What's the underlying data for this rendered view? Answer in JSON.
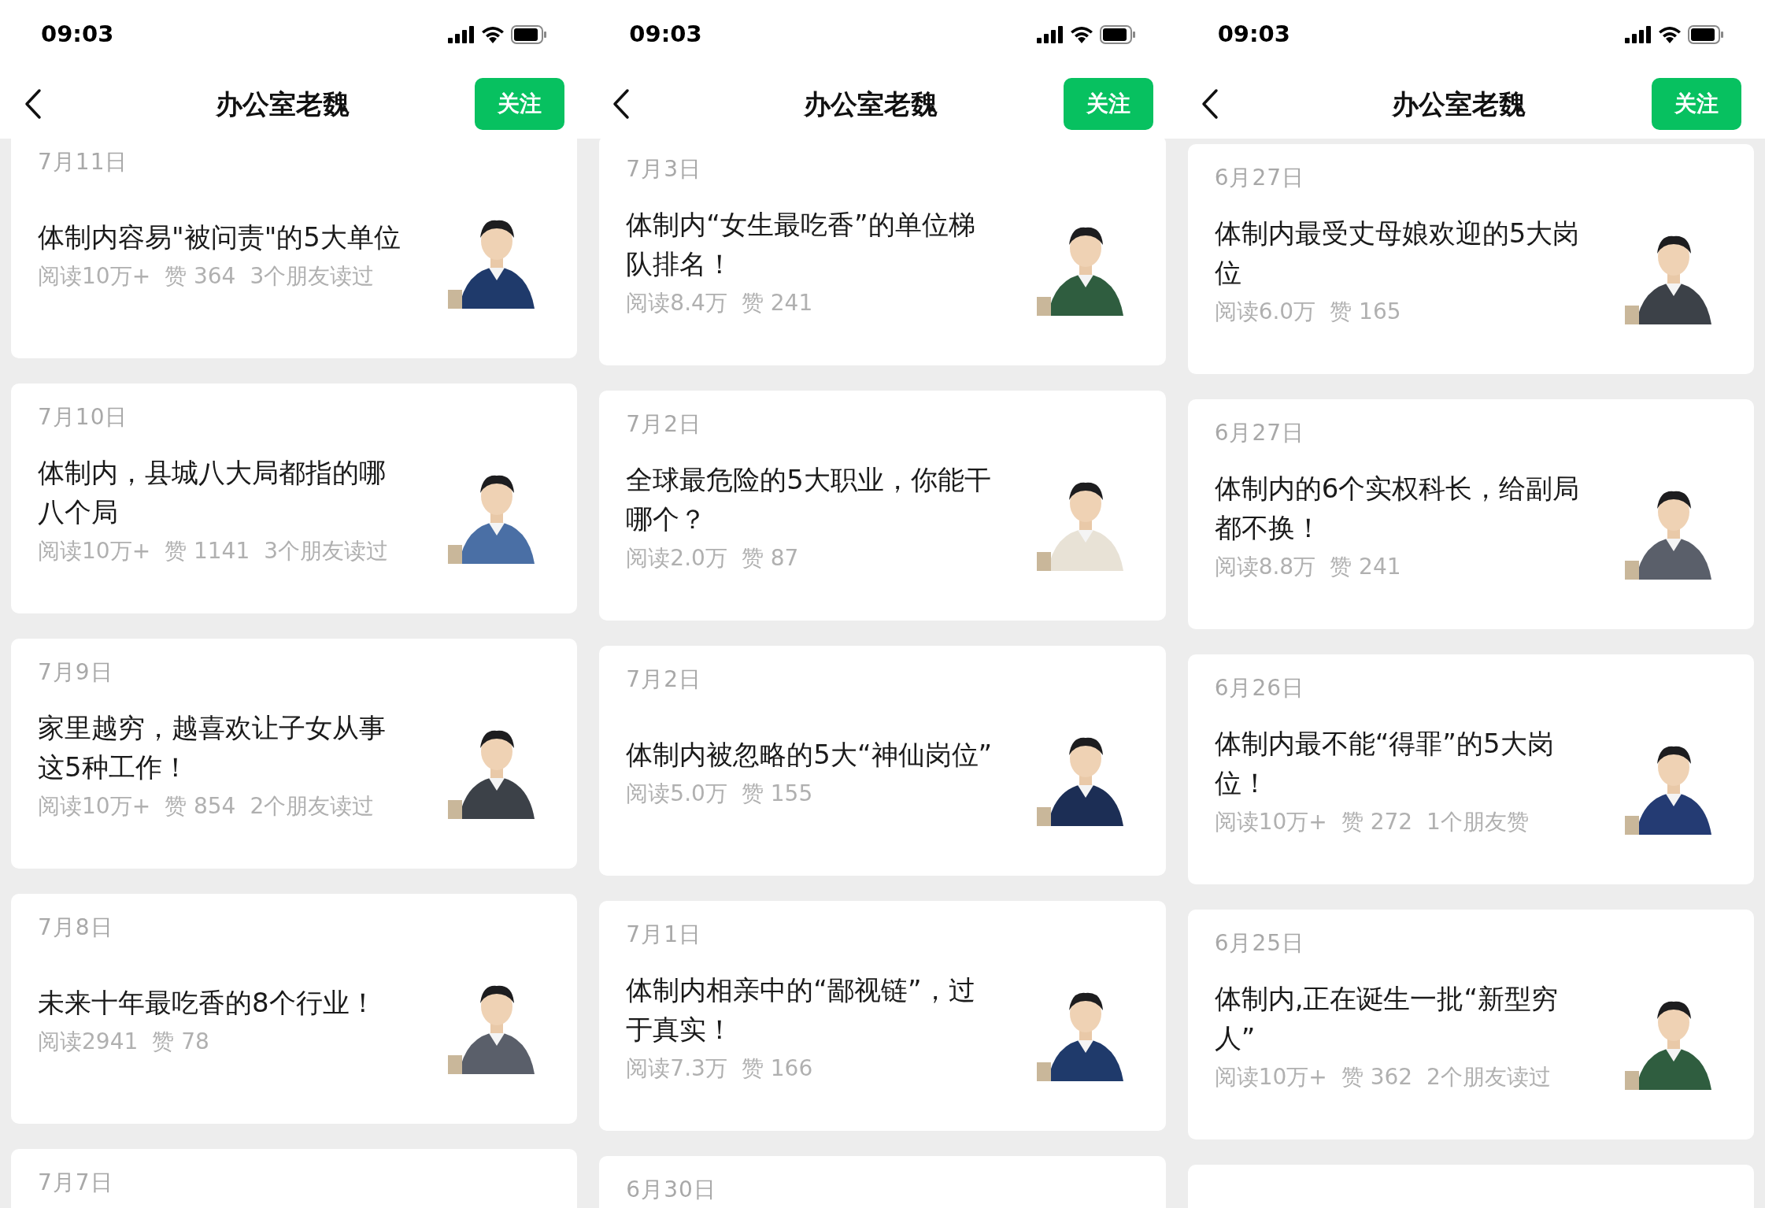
{
  "phones": [
    {
      "status_bar": {
        "time": "09:03"
      },
      "header": {
        "title": "办公室老魏",
        "follow_button": "关注"
      },
      "articles": [
        {
          "kind": "full",
          "date": "7月11日",
          "title": "体制内容易\"被问责\"的5大单位",
          "reads": "阅读10万+",
          "likes": "赞 364",
          "friends": "3个朋友读过"
        },
        {
          "kind": "full",
          "date": "7月10日",
          "title": "体制内，县城八大局都指的哪八个局",
          "reads": "阅读10万+",
          "likes": "赞 1141",
          "friends": "3个朋友读过"
        },
        {
          "kind": "full",
          "date": "7月9日",
          "title": "家里越穷，越喜欢让子女从事这5种工作！",
          "reads": "阅读10万+",
          "likes": "赞 854",
          "friends": "2个朋友读过"
        },
        {
          "kind": "full",
          "date": "7月8日",
          "title": "未来十年最吃香的8个行业！",
          "reads": "阅读2941",
          "likes": "赞 78"
        },
        {
          "kind": "date_only",
          "date": "7月7日"
        }
      ]
    },
    {
      "status_bar": {
        "time": "09:03"
      },
      "header": {
        "title": "办公室老魏",
        "follow_button": "关注"
      },
      "articles": [
        {
          "kind": "full",
          "date": "7月3日",
          "title": "体制内“女生最吃香”的单位梯队排名！",
          "reads": "阅读8.4万",
          "likes": "赞 241"
        },
        {
          "kind": "full",
          "date": "7月2日",
          "title": "全球最危险的5大职业，你能干哪个？",
          "reads": "阅读2.0万",
          "likes": "赞 87"
        },
        {
          "kind": "full",
          "date": "7月2日",
          "title": "体制内被忽略的5大“神仙岗位”",
          "reads": "阅读5.0万",
          "likes": "赞 155"
        },
        {
          "kind": "full",
          "date": "7月1日",
          "title": "体制内相亲中的“鄙视链”，过于真实！",
          "reads": "阅读7.3万",
          "likes": "赞 166"
        },
        {
          "kind": "date_only",
          "date": "6月30日"
        }
      ]
    },
    {
      "status_bar": {
        "time": "09:03"
      },
      "header": {
        "title": "办公室老魏",
        "follow_button": "关注"
      },
      "articles": [
        {
          "kind": "full",
          "date": "6月27日",
          "title": "体制内最受丈母娘欢迎的5大岗位",
          "reads": "阅读6.0万",
          "likes": "赞 165"
        },
        {
          "kind": "full",
          "date": "6月27日",
          "title": "体制内的6个实权科长，给副局都不换！",
          "reads": "阅读8.8万",
          "likes": "赞 241"
        },
        {
          "kind": "full",
          "date": "6月26日",
          "title": "体制内最不能“得罪”的5大岗位！",
          "reads": "阅读10万+",
          "likes": "赞 272",
          "friends": "1个朋友赞"
        },
        {
          "kind": "full",
          "date": "6月25日",
          "title": "体制内,正在诞生一批“新型穷人”",
          "reads": "阅读10万+",
          "likes": "赞 362",
          "friends": "2个朋友读过"
        },
        {
          "kind": "blank"
        }
      ]
    }
  ]
}
